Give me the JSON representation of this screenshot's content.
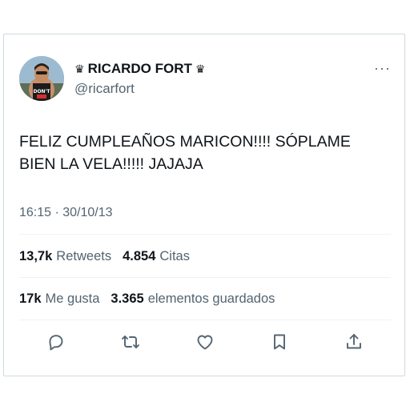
{
  "author": {
    "crown_left": "♛",
    "name": "RICARDO FORT",
    "crown_right": "♛",
    "handle": "@ricarfort"
  },
  "more_menu": "···",
  "tweet": {
    "text": "FELIZ CUMPLEAÑOS MARICON!!!! SÓPLAME\nBIEN LA VELA!!!!! JAJAJA",
    "timestamp": "16:15 · 30/10/13"
  },
  "stats": {
    "retweets_count": "13,7k",
    "retweets_label": "Retweets",
    "quotes_count": "4.854",
    "quotes_label": "Citas",
    "likes_count": "17k",
    "likes_label": "Me gusta",
    "bookmarks_count": "3.365",
    "bookmarks_label": "elementos guardados"
  },
  "actions": {
    "reply_icon": "reply-icon",
    "retweet_icon": "retweet-icon",
    "like_icon": "heart-icon",
    "bookmark_icon": "bookmark-icon",
    "share_icon": "share-icon"
  },
  "colors": {
    "text": "#0f1419",
    "secondary": "#536471",
    "divider": "#eff3f4",
    "border": "#cfd9de"
  }
}
